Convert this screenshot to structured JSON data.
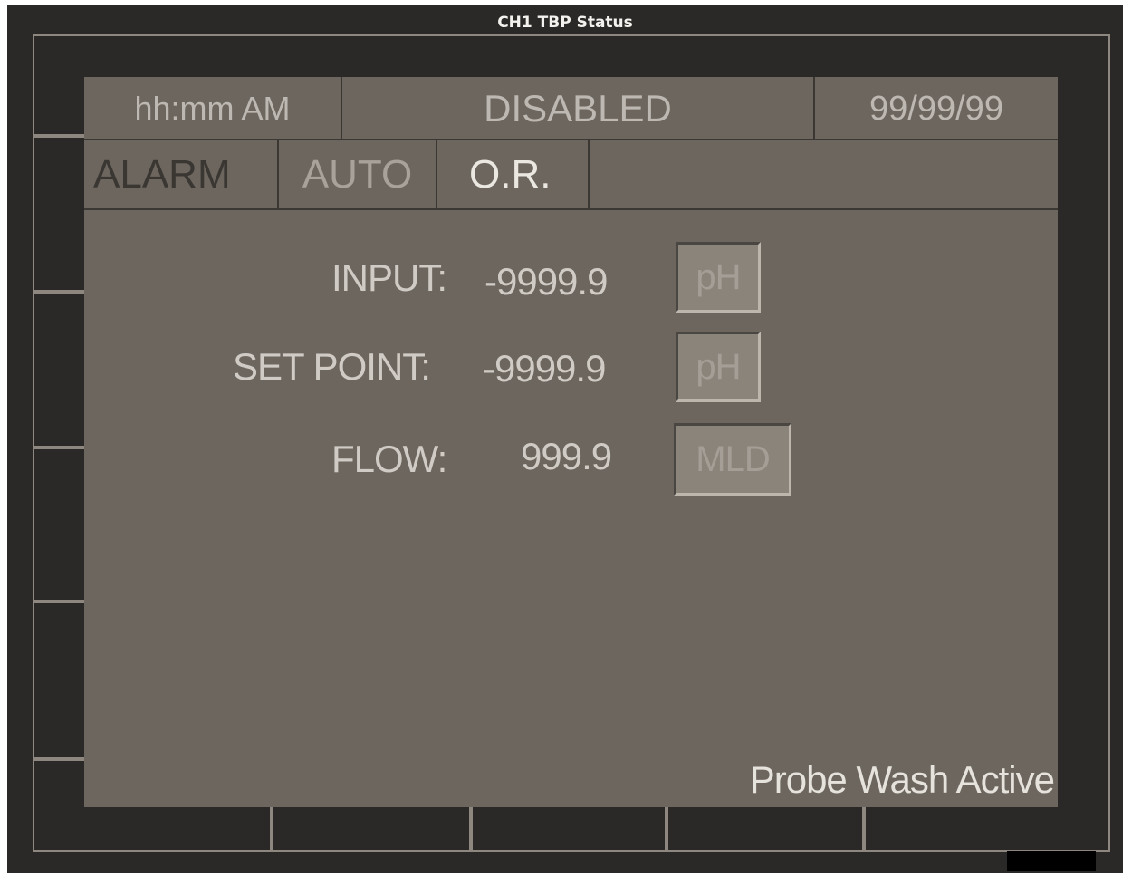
{
  "window": {
    "title": "CH1 TBP Status"
  },
  "status_bar": {
    "time": "hh:mm AM",
    "state": "DISABLED",
    "date": "99/99/99"
  },
  "mode_bar": {
    "alarm": "ALARM",
    "auto": "AUTO",
    "range": "O.R.",
    "extra": ""
  },
  "readings": [
    {
      "label": "INPUT:",
      "value": "-9999.9",
      "unit": "pH"
    },
    {
      "label": "SET POINT:",
      "value": "-9999.9",
      "unit": "pH"
    },
    {
      "label": "FLOW:",
      "value": "999.9",
      "unit": "MLD"
    }
  ],
  "message": "Probe Wash Active",
  "colors": {
    "bezel": "#2b2927",
    "screen": "#6d665f",
    "text_bright": "#e6e2dc",
    "text_dim": "#bdb8b1",
    "button": "#8b847b"
  }
}
